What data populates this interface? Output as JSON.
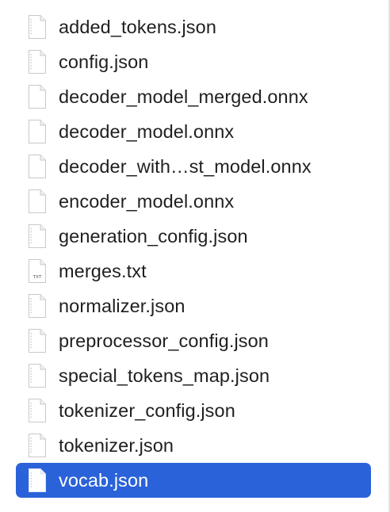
{
  "files": [
    {
      "name": "added_tokens.json",
      "icon": "json-file-icon",
      "selected": false
    },
    {
      "name": "config.json",
      "icon": "json-file-icon",
      "selected": false
    },
    {
      "name": "decoder_model_merged.onnx",
      "icon": "generic-file-icon",
      "selected": false
    },
    {
      "name": "decoder_model.onnx",
      "icon": "generic-file-icon",
      "selected": false
    },
    {
      "name": "decoder_with…st_model.onnx",
      "icon": "generic-file-icon",
      "selected": false
    },
    {
      "name": "encoder_model.onnx",
      "icon": "generic-file-icon",
      "selected": false
    },
    {
      "name": "generation_config.json",
      "icon": "json-file-icon",
      "selected": false
    },
    {
      "name": "merges.txt",
      "icon": "txt-file-icon",
      "icon_label": "TXT",
      "selected": false
    },
    {
      "name": "normalizer.json",
      "icon": "json-file-icon",
      "selected": false
    },
    {
      "name": "preprocessor_config.json",
      "icon": "json-file-icon",
      "selected": false
    },
    {
      "name": "special_tokens_map.json",
      "icon": "json-file-icon",
      "selected": false
    },
    {
      "name": "tokenizer_config.json",
      "icon": "json-file-icon",
      "selected": false
    },
    {
      "name": "tokenizer.json",
      "icon": "json-file-icon",
      "selected": false
    },
    {
      "name": "vocab.json",
      "icon": "json-file-icon",
      "selected": true
    }
  ],
  "colors": {
    "selection": "#2a62d9",
    "text": "#1f1f1f",
    "selected_text": "#ffffff"
  }
}
